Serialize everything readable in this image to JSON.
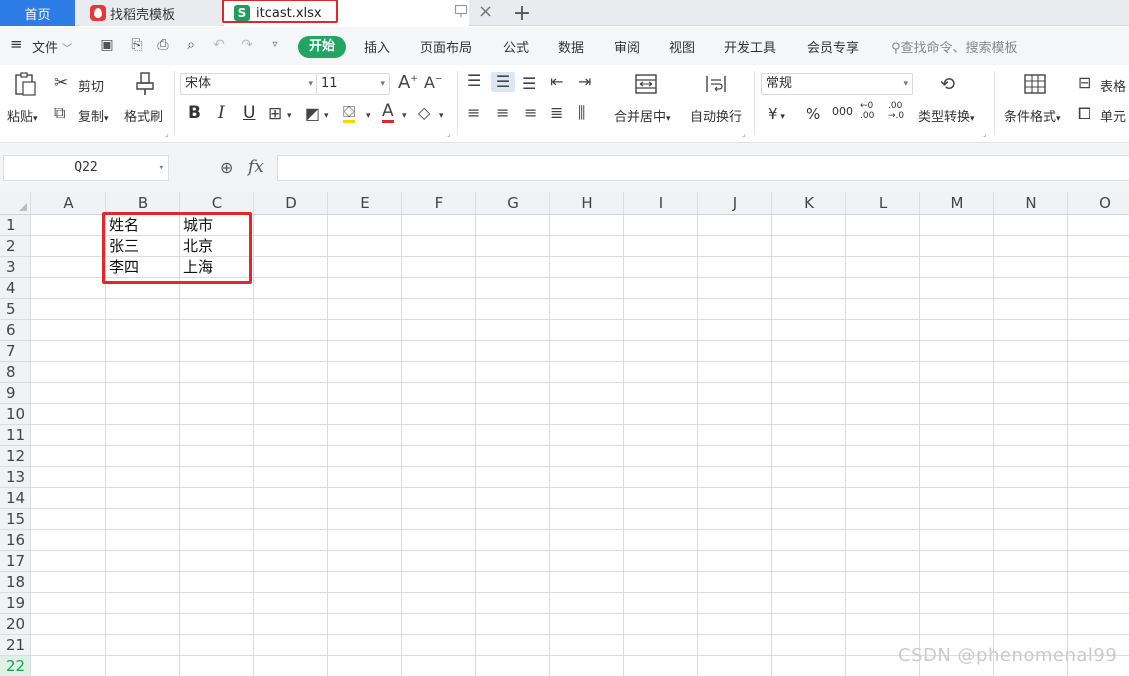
{
  "tabs": {
    "home": "首页",
    "template": "找稻壳模板",
    "file": "itcast.xlsx",
    "file_icon": "S",
    "plus": "+"
  },
  "menu": {
    "file": "文件",
    "start": "开始",
    "items": [
      "插入",
      "页面布局",
      "公式",
      "数据",
      "审阅",
      "视图",
      "开发工具",
      "会员专享"
    ],
    "search_placeholder": "查找命令、搜索模板"
  },
  "ribbon": {
    "paste": "粘贴",
    "cut": "剪切",
    "copy": "复制",
    "format_painter": "格式刷",
    "font_name": "宋体",
    "font_size": "11",
    "bold": "B",
    "italic": "I",
    "underline": "U",
    "merge_center": "合并居中",
    "wrap_text": "自动换行",
    "number_format": "常规",
    "currency": "¥",
    "percent": "%",
    "thousands": "000",
    "inc_decimal_a": "←0",
    "inc_decimal_b": ".00",
    "dec_decimal_a": ".00",
    "dec_decimal_b": "→.0",
    "type_convert": "类型转换",
    "cond_format": "条件格式",
    "table_style": "表格",
    "cell": "单元"
  },
  "formula_bar": {
    "name_box": "Q22",
    "fx": "fx",
    "formula": ""
  },
  "sheet": {
    "columns": [
      "A",
      "B",
      "C",
      "D",
      "E",
      "F",
      "G",
      "H",
      "I",
      "J",
      "K",
      "L",
      "M",
      "N",
      "O"
    ],
    "rows": [
      "1",
      "2",
      "3",
      "4",
      "5",
      "6",
      "7",
      "8",
      "9",
      "10",
      "11",
      "12",
      "13",
      "14",
      "15",
      "16",
      "17",
      "18",
      "19",
      "20",
      "21",
      "22"
    ],
    "cells": {
      "B1": "姓名",
      "C1": "城市",
      "B2": "张三",
      "C2": "北京",
      "B3": "李四",
      "C3": "上海"
    },
    "active_row": "22"
  },
  "watermark": "CSDN @phenomenal99",
  "colors": {
    "accent_green": "#22a563",
    "home_tab_blue": "#2d7be5",
    "highlight_red": "#e3262d"
  }
}
